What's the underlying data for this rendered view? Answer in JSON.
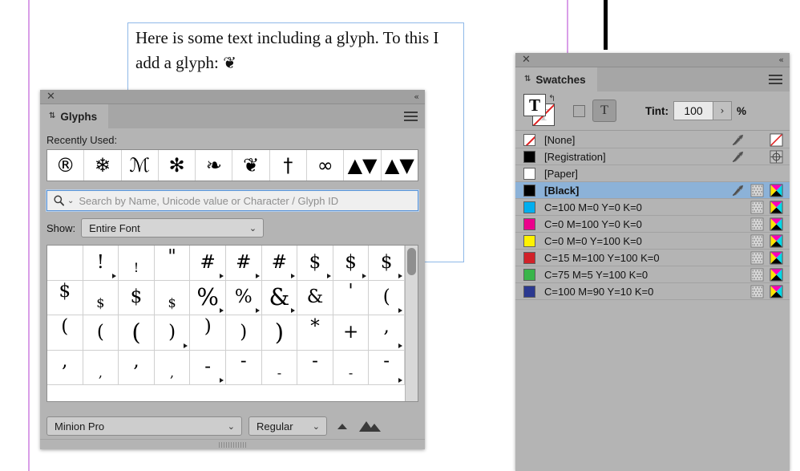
{
  "document": {
    "text_line_1": "Here is some text including a glyph. To this I",
    "text_line_2_prefix": "add a glyph: ",
    "text_line_2_glyph": "❦"
  },
  "glyphs_panel": {
    "titlebar": {
      "close_icon": "✕",
      "collapse_icon": "«"
    },
    "tab": {
      "grip_icon": "⇅",
      "label": "Glyphs"
    },
    "menu_icon": "hamburger-menu-icon",
    "recently_used_label": "Recently Used:",
    "recently_used": [
      {
        "name": "registered-sign-glyph",
        "char": "®",
        "style": ""
      },
      {
        "name": "snowflake-glyph",
        "char": "❄",
        "style": ""
      },
      {
        "name": "swash-capital-m-glyph",
        "char": "ℳ",
        "style": "serif"
      },
      {
        "name": "sun-ornament-glyph",
        "char": "✻",
        "style": ""
      },
      {
        "name": "floral-leaf-ornament-glyph",
        "char": "❧",
        "style": ""
      },
      {
        "name": "rotated-floral-heart-glyph",
        "char": "❦",
        "style": ""
      },
      {
        "name": "dagger-cross-glyph",
        "char": "†",
        "style": ""
      },
      {
        "name": "ampersand-ornament-glyph",
        "char": "∞",
        "style": ""
      },
      {
        "name": "triangle-wave-ornament-glyph",
        "char": "▲▼",
        "style": ""
      },
      {
        "name": "triangle-pair-glyph",
        "char": "▲▼",
        "style": ""
      }
    ],
    "search": {
      "placeholder": "Search by Name, Unicode value or Character / Glyph ID",
      "value": "",
      "icon": "search-icon",
      "chevron": "⌄"
    },
    "show": {
      "label": "Show:",
      "value": "Entire Font",
      "chevron": "⌄"
    },
    "grid": [
      {
        "char": "",
        "cls": ""
      },
      {
        "char": "!",
        "cls": "alt"
      },
      {
        "char": "!",
        "cls": "sm"
      },
      {
        "char": "\"",
        "cls": "up"
      },
      {
        "char": "#",
        "cls": "alt"
      },
      {
        "char": "#",
        "cls": "alt"
      },
      {
        "char": "#",
        "cls": "alt"
      },
      {
        "char": "$",
        "cls": "alt"
      },
      {
        "char": "$",
        "cls": "alt"
      },
      {
        "char": "$",
        "cls": "alt"
      },
      {
        "char": "$",
        "cls": "up"
      },
      {
        "char": "$",
        "cls": "sm"
      },
      {
        "char": "$",
        "cls": ""
      },
      {
        "char": "$",
        "cls": "sm"
      },
      {
        "char": "%",
        "cls": "alt lg"
      },
      {
        "char": "%",
        "cls": "alt"
      },
      {
        "char": "&",
        "cls": "alt lg"
      },
      {
        "char": "&",
        "cls": ""
      },
      {
        "char": "'",
        "cls": "up"
      },
      {
        "char": "(",
        "cls": "alt"
      },
      {
        "char": "(",
        "cls": "up"
      },
      {
        "char": "(",
        "cls": ""
      },
      {
        "char": "(",
        "cls": "lg"
      },
      {
        "char": ")",
        "cls": "alt"
      },
      {
        "char": ")",
        "cls": "up"
      },
      {
        "char": ")",
        "cls": ""
      },
      {
        "char": ")",
        "cls": "lg"
      },
      {
        "char": "*",
        "cls": "up"
      },
      {
        "char": "+",
        "cls": ""
      },
      {
        "char": ",",
        "cls": "alt up"
      },
      {
        "char": ",",
        "cls": "up"
      },
      {
        "char": ",",
        "cls": "sm"
      },
      {
        "char": ",",
        "cls": "up"
      },
      {
        "char": ",",
        "cls": "sm"
      },
      {
        "char": "-",
        "cls": "alt"
      },
      {
        "char": "-",
        "cls": "up"
      },
      {
        "char": "-",
        "cls": "sm"
      },
      {
        "char": "-",
        "cls": "up"
      },
      {
        "char": "-",
        "cls": "sm"
      },
      {
        "char": "-",
        "cls": "alt up"
      }
    ],
    "footer": {
      "font_family": "Minion Pro",
      "font_style": "Regular",
      "chevron": "⌄",
      "zoom_out_icon": "small-glyph-size-icon",
      "zoom_in_icon": "large-glyph-size-icon"
    }
  },
  "swatches_panel": {
    "titlebar": {
      "close_icon": "✕",
      "collapse_icon": "«"
    },
    "tab": {
      "grip_icon": "⇅",
      "label": "Swatches"
    },
    "menu_icon": "hamburger-menu-icon",
    "controls": {
      "fill_label": "T",
      "stroke_label": "T",
      "swap_icon": "↰",
      "affect_container_icon": "formatting-affects-container-icon",
      "affect_text_label": "T",
      "tint_label": "Tint:",
      "tint_value": "100",
      "tint_stepper_icon": "›",
      "tint_unit": "%"
    },
    "swatches": [
      {
        "name": "[None]",
        "color": "none",
        "selected": false,
        "icons": [
          "eyedropper-disabled-icon",
          "",
          "none-swatch-icon"
        ]
      },
      {
        "name": "[Registration]",
        "color": "#000000",
        "selected": false,
        "icons": [
          "eyedropper-disabled-icon",
          "",
          "registration-target-icon"
        ]
      },
      {
        "name": "[Paper]",
        "color": "#ffffff",
        "selected": false,
        "icons": [
          "",
          "",
          ""
        ]
      },
      {
        "name": "[Black]",
        "color": "#000000",
        "selected": true,
        "icons": [
          "eyedropper-disabled-icon",
          "halftone-pattern-icon",
          "cmyk-color-mode-icon"
        ]
      },
      {
        "name": "C=100 M=0 Y=0 K=0",
        "color": "#00aeef",
        "selected": false,
        "icons": [
          "",
          "halftone-pattern-icon",
          "cmyk-color-mode-icon"
        ]
      },
      {
        "name": "C=0 M=100 Y=0 K=0",
        "color": "#ec008c",
        "selected": false,
        "icons": [
          "",
          "halftone-pattern-icon",
          "cmyk-color-mode-icon"
        ]
      },
      {
        "name": "C=0 M=0 Y=100 K=0",
        "color": "#fff200",
        "selected": false,
        "icons": [
          "",
          "halftone-pattern-icon",
          "cmyk-color-mode-icon"
        ]
      },
      {
        "name": "C=15 M=100 Y=100 K=0",
        "color": "#d12229",
        "selected": false,
        "icons": [
          "",
          "halftone-pattern-icon",
          "cmyk-color-mode-icon"
        ]
      },
      {
        "name": "C=75 M=5 Y=100 K=0",
        "color": "#39b54a",
        "selected": false,
        "icons": [
          "",
          "halftone-pattern-icon",
          "cmyk-color-mode-icon"
        ]
      },
      {
        "name": "C=100 M=90 Y=10 K=0",
        "color": "#2b3990",
        "selected": false,
        "icons": [
          "",
          "halftone-pattern-icon",
          "cmyk-color-mode-icon"
        ]
      }
    ]
  },
  "colors": {
    "panel_bg": "#b4b4b4",
    "selection": "#8cb2d8",
    "guide": "#d99fe8",
    "frame_border": "#8fb8e8"
  }
}
